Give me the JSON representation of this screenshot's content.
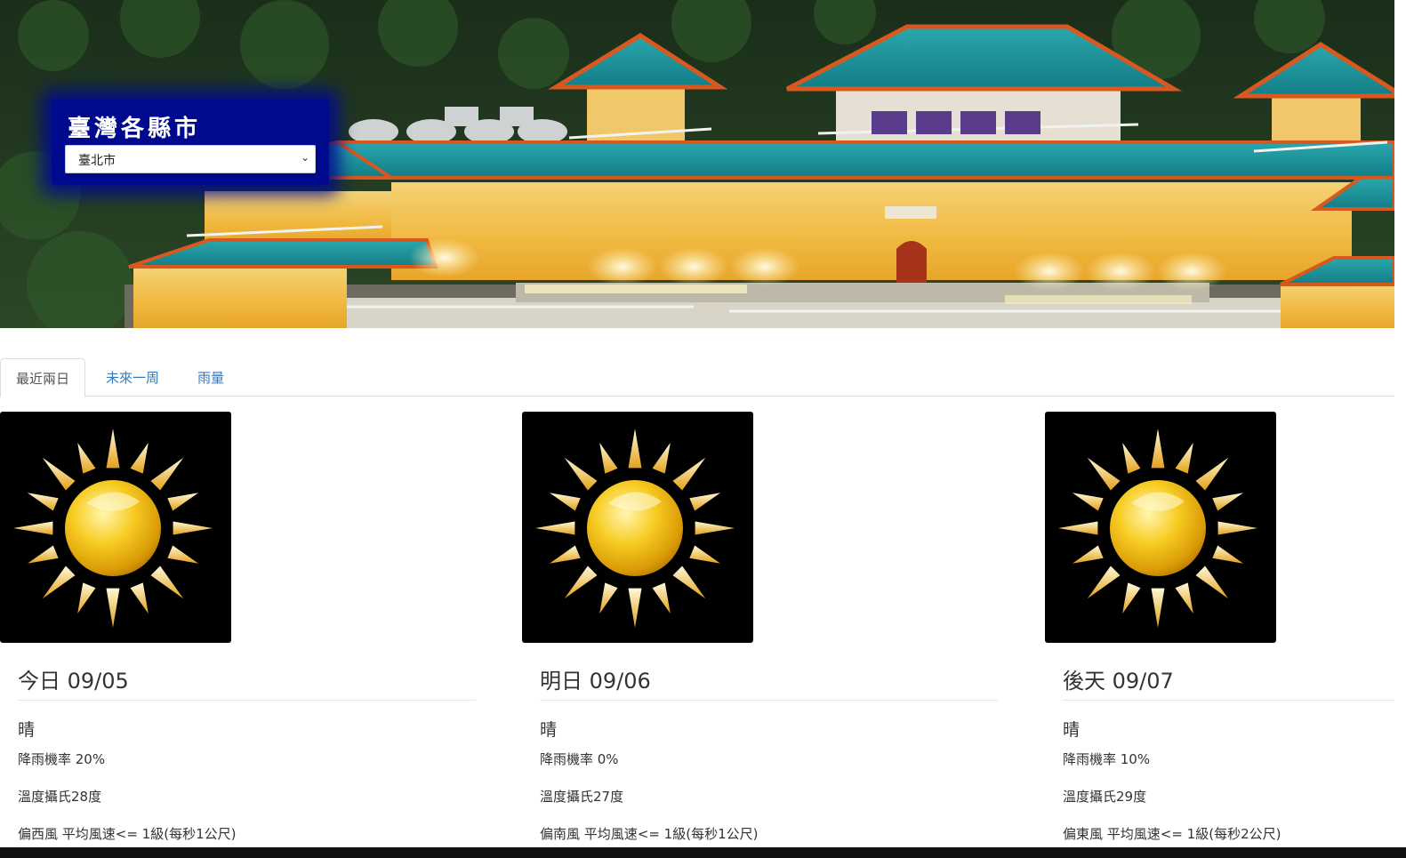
{
  "hero": {
    "city_title": "臺灣各縣市",
    "city_select_value": "臺北市"
  },
  "tabs": [
    {
      "label": "最近兩日",
      "active": true
    },
    {
      "label": "未來一周",
      "active": false
    },
    {
      "label": "雨量",
      "active": false
    }
  ],
  "days": [
    {
      "date": "今日 09/05",
      "weather": "晴",
      "rain": "降雨機率 20%",
      "temp": "溫度攝氏28度",
      "wind": "偏西風 平均風速<= 1級(每秒1公尺)",
      "icon": "sun-icon"
    },
    {
      "date": "明日 09/06",
      "weather": "晴",
      "rain": "降雨機率 0%",
      "temp": "溫度攝氏27度",
      "wind": "偏南風 平均風速<= 1級(每秒1公尺)",
      "icon": "sun-icon"
    },
    {
      "date": "後天 09/07",
      "weather": "晴",
      "rain": "降雨機率 10%",
      "temp": "溫度攝氏29度",
      "wind": "偏東風 平均風速<= 1級(每秒2公尺)",
      "icon": "sun-icon"
    }
  ],
  "colors": {
    "link": "#337ab7",
    "city_box": "#000a8f",
    "roof": "#1e9aa0",
    "wall": "#f2c14e"
  }
}
